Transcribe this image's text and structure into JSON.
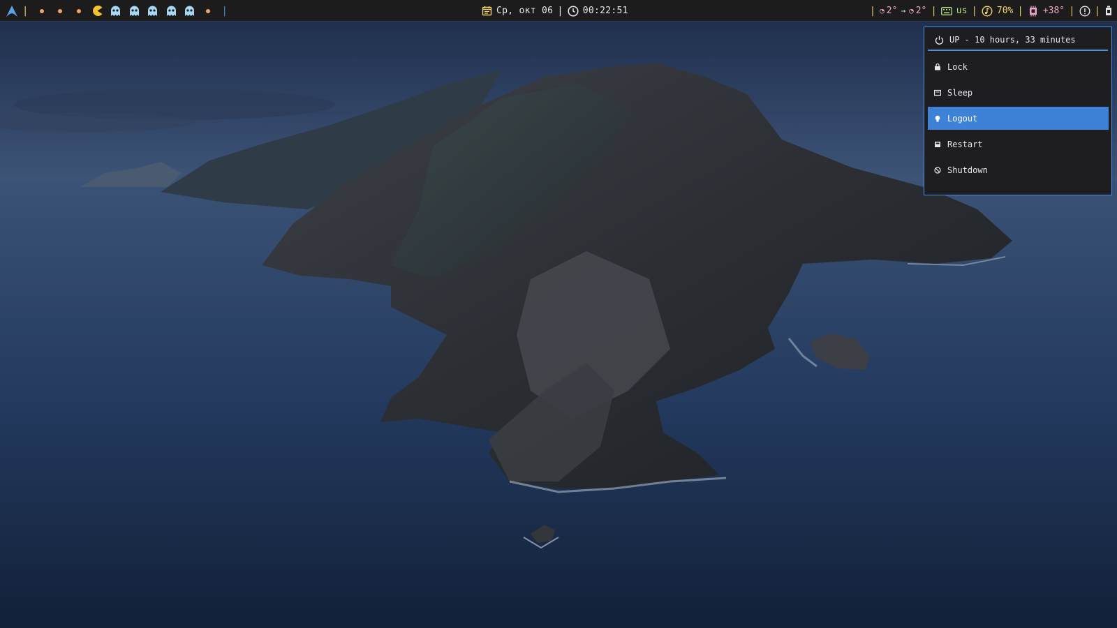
{
  "topbar": {
    "logo_icon": "arch-linux-icon",
    "workspaces": [
      {
        "icon": "dot-icon"
      },
      {
        "icon": "dot-icon"
      },
      {
        "icon": "dot-icon"
      },
      {
        "icon": "pacman-icon"
      },
      {
        "icon": "ghost-icon"
      },
      {
        "icon": "ghost-icon"
      },
      {
        "icon": "ghost-icon"
      },
      {
        "icon": "ghost-icon"
      },
      {
        "icon": "ghost-icon"
      },
      {
        "icon": "dot-icon"
      }
    ],
    "date": "Ср, окт 06",
    "time": "00:22:51",
    "weather_from": "2°",
    "weather_to": "2°",
    "weather_arrow": "→",
    "keyboard_layout": "us",
    "volume": "70%",
    "cpu_temp": "+38°"
  },
  "power_menu": {
    "header": "UP - 10 hours, 33 minutes",
    "items": [
      {
        "label": "Lock",
        "icon": "lock-icon"
      },
      {
        "label": "Sleep",
        "icon": "sleep-icon"
      },
      {
        "label": "Logout",
        "icon": "logout-icon"
      },
      {
        "label": "Restart",
        "icon": "restart-icon"
      },
      {
        "label": "Shutdown",
        "icon": "shutdown-icon"
      }
    ],
    "selected_index": 2
  },
  "colors": {
    "accent": "#4a8fe0",
    "selected_bg": "#3d82d6",
    "bar_bg": "#1c1c1c",
    "separator": "#e0c36a"
  }
}
